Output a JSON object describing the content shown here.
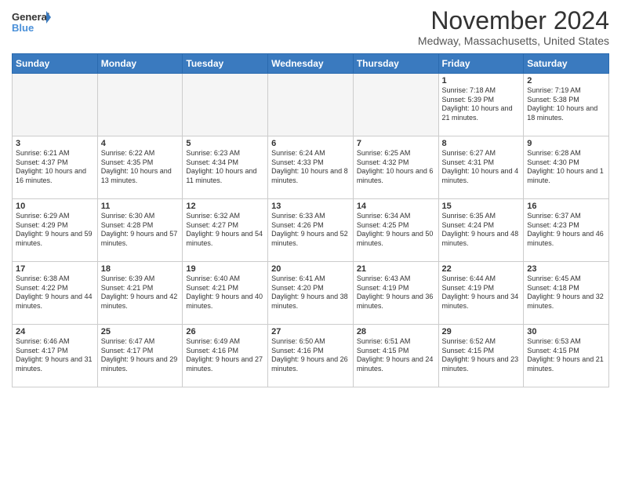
{
  "logo": {
    "text_general": "General",
    "text_blue": "Blue"
  },
  "title": "November 2024",
  "location": "Medway, Massachusetts, United States",
  "days_of_week": [
    "Sunday",
    "Monday",
    "Tuesday",
    "Wednesday",
    "Thursday",
    "Friday",
    "Saturday"
  ],
  "weeks": [
    [
      {
        "day": "",
        "sunrise": "",
        "sunset": "",
        "daylight": "",
        "empty": true
      },
      {
        "day": "",
        "sunrise": "",
        "sunset": "",
        "daylight": "",
        "empty": true
      },
      {
        "day": "",
        "sunrise": "",
        "sunset": "",
        "daylight": "",
        "empty": true
      },
      {
        "day": "",
        "sunrise": "",
        "sunset": "",
        "daylight": "",
        "empty": true
      },
      {
        "day": "",
        "sunrise": "",
        "sunset": "",
        "daylight": "",
        "empty": true
      },
      {
        "day": "1",
        "sunrise": "Sunrise: 7:18 AM",
        "sunset": "Sunset: 5:39 PM",
        "daylight": "Daylight: 10 hours and 21 minutes.",
        "empty": false
      },
      {
        "day": "2",
        "sunrise": "Sunrise: 7:19 AM",
        "sunset": "Sunset: 5:38 PM",
        "daylight": "Daylight: 10 hours and 18 minutes.",
        "empty": false
      }
    ],
    [
      {
        "day": "3",
        "sunrise": "Sunrise: 6:21 AM",
        "sunset": "Sunset: 4:37 PM",
        "daylight": "Daylight: 10 hours and 16 minutes.",
        "empty": false
      },
      {
        "day": "4",
        "sunrise": "Sunrise: 6:22 AM",
        "sunset": "Sunset: 4:35 PM",
        "daylight": "Daylight: 10 hours and 13 minutes.",
        "empty": false
      },
      {
        "day": "5",
        "sunrise": "Sunrise: 6:23 AM",
        "sunset": "Sunset: 4:34 PM",
        "daylight": "Daylight: 10 hours and 11 minutes.",
        "empty": false
      },
      {
        "day": "6",
        "sunrise": "Sunrise: 6:24 AM",
        "sunset": "Sunset: 4:33 PM",
        "daylight": "Daylight: 10 hours and 8 minutes.",
        "empty": false
      },
      {
        "day": "7",
        "sunrise": "Sunrise: 6:25 AM",
        "sunset": "Sunset: 4:32 PM",
        "daylight": "Daylight: 10 hours and 6 minutes.",
        "empty": false
      },
      {
        "day": "8",
        "sunrise": "Sunrise: 6:27 AM",
        "sunset": "Sunset: 4:31 PM",
        "daylight": "Daylight: 10 hours and 4 minutes.",
        "empty": false
      },
      {
        "day": "9",
        "sunrise": "Sunrise: 6:28 AM",
        "sunset": "Sunset: 4:30 PM",
        "daylight": "Daylight: 10 hours and 1 minute.",
        "empty": false
      }
    ],
    [
      {
        "day": "10",
        "sunrise": "Sunrise: 6:29 AM",
        "sunset": "Sunset: 4:29 PM",
        "daylight": "Daylight: 9 hours and 59 minutes.",
        "empty": false
      },
      {
        "day": "11",
        "sunrise": "Sunrise: 6:30 AM",
        "sunset": "Sunset: 4:28 PM",
        "daylight": "Daylight: 9 hours and 57 minutes.",
        "empty": false
      },
      {
        "day": "12",
        "sunrise": "Sunrise: 6:32 AM",
        "sunset": "Sunset: 4:27 PM",
        "daylight": "Daylight: 9 hours and 54 minutes.",
        "empty": false
      },
      {
        "day": "13",
        "sunrise": "Sunrise: 6:33 AM",
        "sunset": "Sunset: 4:26 PM",
        "daylight": "Daylight: 9 hours and 52 minutes.",
        "empty": false
      },
      {
        "day": "14",
        "sunrise": "Sunrise: 6:34 AM",
        "sunset": "Sunset: 4:25 PM",
        "daylight": "Daylight: 9 hours and 50 minutes.",
        "empty": false
      },
      {
        "day": "15",
        "sunrise": "Sunrise: 6:35 AM",
        "sunset": "Sunset: 4:24 PM",
        "daylight": "Daylight: 9 hours and 48 minutes.",
        "empty": false
      },
      {
        "day": "16",
        "sunrise": "Sunrise: 6:37 AM",
        "sunset": "Sunset: 4:23 PM",
        "daylight": "Daylight: 9 hours and 46 minutes.",
        "empty": false
      }
    ],
    [
      {
        "day": "17",
        "sunrise": "Sunrise: 6:38 AM",
        "sunset": "Sunset: 4:22 PM",
        "daylight": "Daylight: 9 hours and 44 minutes.",
        "empty": false
      },
      {
        "day": "18",
        "sunrise": "Sunrise: 6:39 AM",
        "sunset": "Sunset: 4:21 PM",
        "daylight": "Daylight: 9 hours and 42 minutes.",
        "empty": false
      },
      {
        "day": "19",
        "sunrise": "Sunrise: 6:40 AM",
        "sunset": "Sunset: 4:21 PM",
        "daylight": "Daylight: 9 hours and 40 minutes.",
        "empty": false
      },
      {
        "day": "20",
        "sunrise": "Sunrise: 6:41 AM",
        "sunset": "Sunset: 4:20 PM",
        "daylight": "Daylight: 9 hours and 38 minutes.",
        "empty": false
      },
      {
        "day": "21",
        "sunrise": "Sunrise: 6:43 AM",
        "sunset": "Sunset: 4:19 PM",
        "daylight": "Daylight: 9 hours and 36 minutes.",
        "empty": false
      },
      {
        "day": "22",
        "sunrise": "Sunrise: 6:44 AM",
        "sunset": "Sunset: 4:19 PM",
        "daylight": "Daylight: 9 hours and 34 minutes.",
        "empty": false
      },
      {
        "day": "23",
        "sunrise": "Sunrise: 6:45 AM",
        "sunset": "Sunset: 4:18 PM",
        "daylight": "Daylight: 9 hours and 32 minutes.",
        "empty": false
      }
    ],
    [
      {
        "day": "24",
        "sunrise": "Sunrise: 6:46 AM",
        "sunset": "Sunset: 4:17 PM",
        "daylight": "Daylight: 9 hours and 31 minutes.",
        "empty": false
      },
      {
        "day": "25",
        "sunrise": "Sunrise: 6:47 AM",
        "sunset": "Sunset: 4:17 PM",
        "daylight": "Daylight: 9 hours and 29 minutes.",
        "empty": false
      },
      {
        "day": "26",
        "sunrise": "Sunrise: 6:49 AM",
        "sunset": "Sunset: 4:16 PM",
        "daylight": "Daylight: 9 hours and 27 minutes.",
        "empty": false
      },
      {
        "day": "27",
        "sunrise": "Sunrise: 6:50 AM",
        "sunset": "Sunset: 4:16 PM",
        "daylight": "Daylight: 9 hours and 26 minutes.",
        "empty": false
      },
      {
        "day": "28",
        "sunrise": "Sunrise: 6:51 AM",
        "sunset": "Sunset: 4:15 PM",
        "daylight": "Daylight: 9 hours and 24 minutes.",
        "empty": false
      },
      {
        "day": "29",
        "sunrise": "Sunrise: 6:52 AM",
        "sunset": "Sunset: 4:15 PM",
        "daylight": "Daylight: 9 hours and 23 minutes.",
        "empty": false
      },
      {
        "day": "30",
        "sunrise": "Sunrise: 6:53 AM",
        "sunset": "Sunset: 4:15 PM",
        "daylight": "Daylight: 9 hours and 21 minutes.",
        "empty": false
      }
    ]
  ]
}
